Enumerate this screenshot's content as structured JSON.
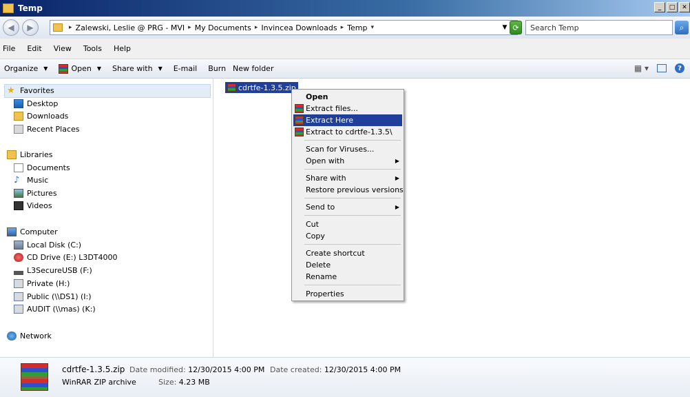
{
  "window": {
    "title": "Temp"
  },
  "address": {
    "crumbs": [
      "Zalewski, Leslie @ PRG - MVI",
      "My Documents",
      "Invincea Downloads",
      "Temp"
    ]
  },
  "search": {
    "placeholder": "Search Temp"
  },
  "menu": [
    "File",
    "Edit",
    "View",
    "Tools",
    "Help"
  ],
  "toolbar": {
    "organize": "Organize",
    "open": "Open",
    "share_with": "Share with",
    "email": "E-mail",
    "burn": "Burn",
    "new_folder": "New folder"
  },
  "nav": {
    "favorites": "Favorites",
    "desktop": "Desktop",
    "downloads": "Downloads",
    "recent_places": "Recent Places",
    "libraries": "Libraries",
    "documents": "Documents",
    "music": "Music",
    "pictures": "Pictures",
    "videos": "Videos",
    "computer": "Computer",
    "local_disk": "Local Disk (C:)",
    "cd_drive": "CD Drive (E:) L3DT4000",
    "secure_usb": "L3SecureUSB (F:)",
    "private": "Private (H:)",
    "public": "Public (\\\\DS1) (I:)",
    "audit": "AUDIT (\\\\mas) (K:)",
    "network": "Network"
  },
  "file": {
    "name": "cdrtfe-1.3.5.zip"
  },
  "context_menu": {
    "open": "Open",
    "extract_files": "Extract files...",
    "extract_here": "Extract Here",
    "extract_to": "Extract to cdrtfe-1.3.5\\",
    "scan": "Scan for Viruses...",
    "open_with": "Open with",
    "share_with": "Share with",
    "restore": "Restore previous versions",
    "send_to": "Send to",
    "cut": "Cut",
    "copy": "Copy",
    "create_shortcut": "Create shortcut",
    "delete": "Delete",
    "rename": "Rename",
    "properties": "Properties"
  },
  "details": {
    "name": "cdrtfe-1.3.5.zip",
    "type": "WinRAR ZIP archive",
    "modified_label": "Date modified:",
    "modified_value": "12/30/2015 4:00 PM",
    "size_label": "Size:",
    "size_value": "4.23 MB",
    "created_label": "Date created:",
    "created_value": "12/30/2015 4:00 PM"
  },
  "colors": {
    "selection": "#1f3f9b",
    "title_start": "#0a246a"
  }
}
